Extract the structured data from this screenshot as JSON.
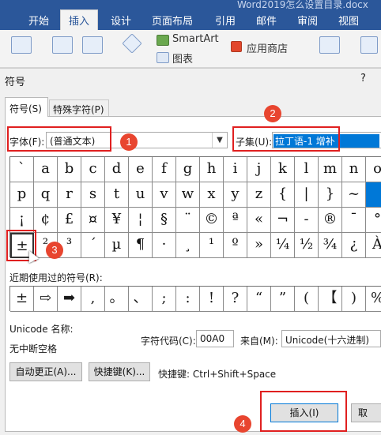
{
  "document": {
    "title": "Word2019怎么设置目录.docx"
  },
  "ribbon": {
    "tabs": [
      "开始",
      "插入",
      "设计",
      "页面布局",
      "引用",
      "邮件",
      "审阅",
      "视图"
    ],
    "active_tab": "插入",
    "items": {
      "smartart": "SmartArt",
      "chart": "图表",
      "app_store": "应用商店"
    }
  },
  "dialog": {
    "title": "符号",
    "help": "?",
    "tabs": [
      "符号(S)",
      "特殊字符(P)"
    ],
    "font_label": "字体(F):",
    "font_value": "(普通文本)",
    "subset_label": "子集(U):",
    "subset_value": "拉丁语-1 增补",
    "symbols": [
      [
        "ˋ",
        "a",
        "b",
        "c",
        "d",
        "e",
        "f",
        "g",
        "h",
        "i",
        "j",
        "k",
        "l",
        "m",
        "n",
        "o"
      ],
      [
        "p",
        "q",
        "r",
        "s",
        "t",
        "u",
        "v",
        "w",
        "x",
        "y",
        "z",
        "{",
        "|",
        "}",
        "~",
        ""
      ],
      [
        "¡",
        "¢",
        "£",
        "¤",
        "¥",
        "¦",
        "§",
        "¨",
        "©",
        "ª",
        "«",
        "¬",
        "-",
        "®",
        "¯",
        "°"
      ],
      [
        "±",
        "²",
        "³",
        "´",
        "µ",
        "¶",
        "·",
        "¸",
        "¹",
        "º",
        "»",
        "¼",
        "½",
        "¾",
        "¿",
        "À"
      ]
    ],
    "recent_label": "近期使用过的符号(R):",
    "recent_symbols": [
      "±",
      "⇨",
      "➡",
      ",",
      "。",
      "、",
      ";",
      ":",
      "!",
      "?",
      "“",
      "”",
      "(",
      "【",
      ")",
      "%"
    ],
    "unicode_name_label": "Unicode 名称:",
    "unicode_name_value": "无中断空格",
    "char_code_label": "字符代码(C):",
    "char_code_value": "00A0",
    "from_label": "来自(M):",
    "from_value": "Unicode(十六进制)",
    "autocorrect_button": "自动更正(A)...",
    "shortcut_key_button": "快捷键(K)...",
    "shortcut_text": "快捷键: Ctrl+Shift+Space",
    "insert_button": "插入(I)",
    "cancel_button": "取"
  },
  "annotations": [
    "1",
    "2",
    "3",
    "4"
  ],
  "colors": {
    "accent": "#2b579a",
    "selection": "#0078d7",
    "annotation": "#e02020"
  }
}
